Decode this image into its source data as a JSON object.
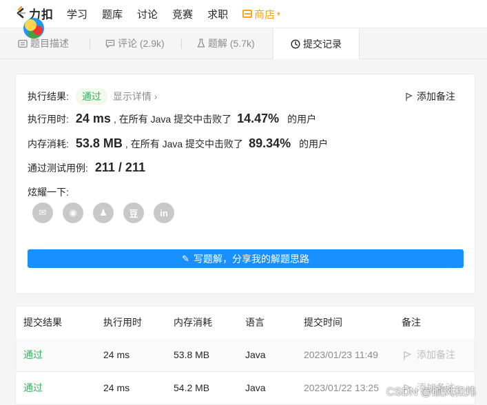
{
  "topbar": {
    "logo_text": "力扣",
    "nav": [
      "学习",
      "题库",
      "讨论",
      "竞赛",
      "求职"
    ],
    "store_label": "商店",
    "store_caret": "▾",
    "accent": "#ffa116"
  },
  "tabs": [
    {
      "label": "题目描述",
      "icon": "document-icon"
    },
    {
      "label": "评论 (2.9k)",
      "icon": "comment-icon"
    },
    {
      "label": "题解 (5.7k)",
      "icon": "flask-icon"
    },
    {
      "label": "提交记录",
      "icon": "clock-icon",
      "active": true
    }
  ],
  "result": {
    "exec_result_label": "执行结果:",
    "status": "通过",
    "show_details": "显示详情",
    "details_chevron": "›",
    "add_note": "添加备注",
    "runtime_label": "执行用时:",
    "runtime_value": "24 ms",
    "runtime_mid": ", 在所有 Java 提交中击败了",
    "runtime_pct": "14.47%",
    "memory_label": "内存消耗:",
    "memory_value": "53.8 MB",
    "memory_mid": ", 在所有 Java 提交中击败了",
    "memory_pct": "89.34%",
    "users_suffix": "的用户",
    "tests_label": "通过测试用例:",
    "tests_value": "211 / 211",
    "share_label": "炫耀一下:",
    "share_icons": [
      {
        "name": "wechat-icon",
        "glyph": "✉"
      },
      {
        "name": "weibo-icon",
        "glyph": "◉"
      },
      {
        "name": "qq-icon",
        "glyph": "♟"
      },
      {
        "name": "douban-icon",
        "glyph": "豆"
      },
      {
        "name": "linkedin-icon",
        "glyph": "in"
      }
    ],
    "write_solution": "写题解，分享我的解题思路",
    "pencil_glyph": "✎",
    "pass_color": "#2db55d",
    "button_color": "#1890ff"
  },
  "table": {
    "headers": [
      "提交结果",
      "执行用时",
      "内存消耗",
      "语言",
      "提交时间",
      "备注"
    ],
    "rows": [
      {
        "result": "通过",
        "time": "24 ms",
        "memory": "53.8 MB",
        "lang": "Java",
        "submitted": "2023/01/23 11:49",
        "note": "添加备注"
      },
      {
        "result": "通过",
        "time": "24 ms",
        "memory": "54.2 MB",
        "lang": "Java",
        "submitted": "2023/01/22 13:25",
        "note": "添加备注"
      }
    ]
  },
  "watermark": "CSDN @硕风和炜"
}
